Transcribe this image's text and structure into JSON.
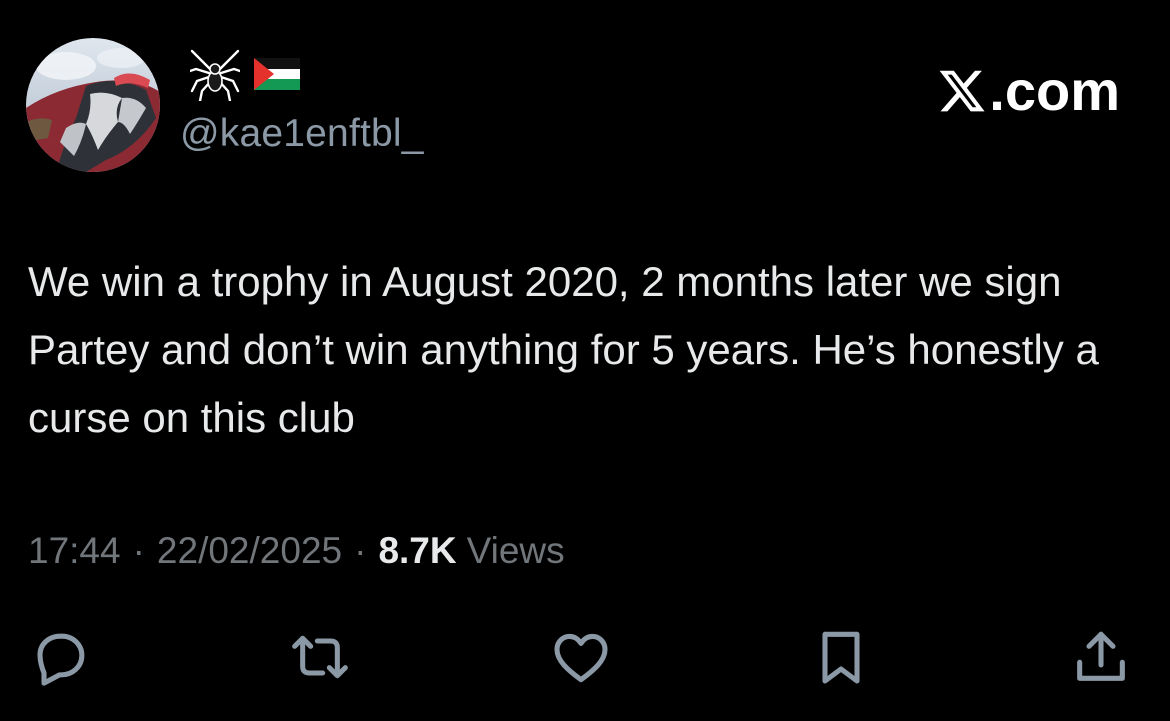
{
  "author": {
    "handle": "@kae1enftbl_",
    "name_emojis": [
      "spider-emoji",
      "palestine-flag-emoji"
    ]
  },
  "brand": {
    "label": ".com",
    "logo": "x-logo"
  },
  "tweet": {
    "text": "We win a trophy in August 2020, 2 months later we sign Partey and don’t win anything for 5 years. He’s honestly a curse on this club",
    "time": "17:44",
    "date": "22/02/2025",
    "separator": "·",
    "views_count": "8.7K",
    "views_label": "Views"
  },
  "actions": [
    "reply-icon",
    "repost-icon",
    "like-icon",
    "bookmark-icon",
    "share-icon"
  ],
  "colors": {
    "background": "#000000",
    "text": "#e7e9ea",
    "secondary": "#71767b",
    "icon": "#8b98a5"
  }
}
